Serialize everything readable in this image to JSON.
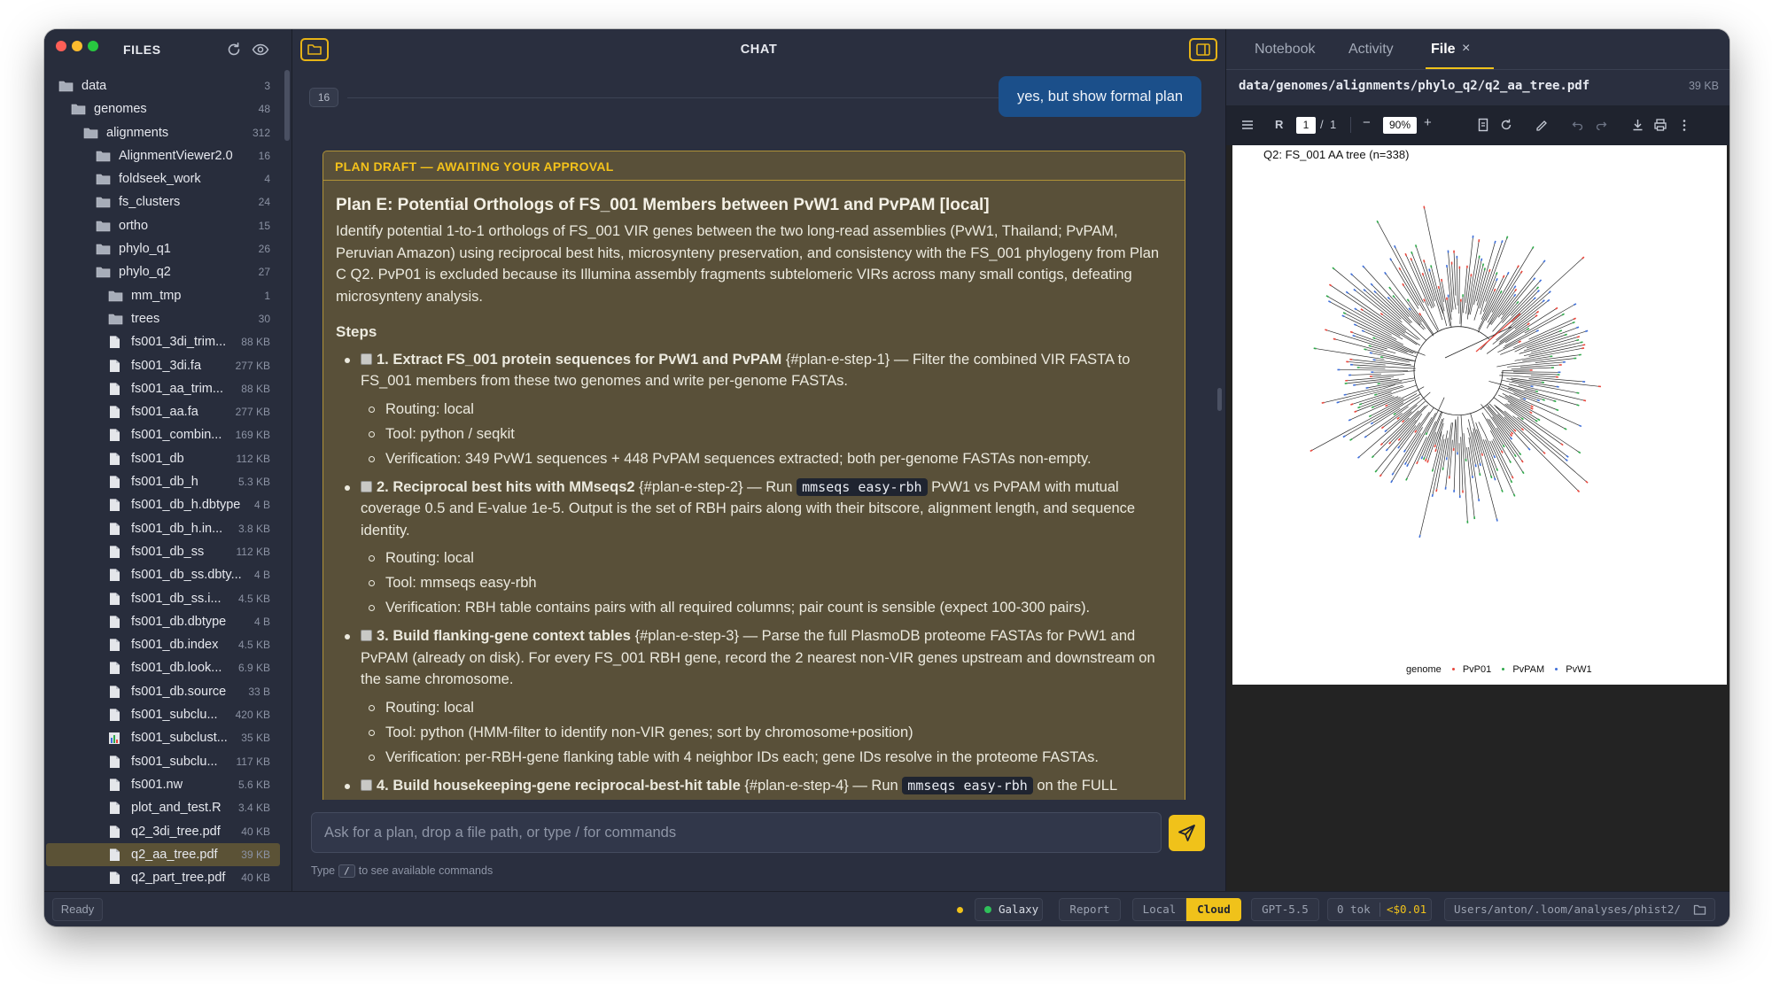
{
  "sidebar": {
    "title": "FILES",
    "tree": [
      {
        "name": "data",
        "count": "3",
        "type": "folder",
        "depth": 0
      },
      {
        "name": "genomes",
        "count": "48",
        "type": "folder",
        "depth": 1
      },
      {
        "name": "alignments",
        "count": "312",
        "type": "folder",
        "depth": 2
      },
      {
        "name": "AlignmentViewer2.0",
        "count": "16",
        "type": "folder",
        "depth": 3
      },
      {
        "name": "foldseek_work",
        "count": "4",
        "type": "folder",
        "depth": 3
      },
      {
        "name": "fs_clusters",
        "count": "24",
        "type": "folder",
        "depth": 3
      },
      {
        "name": "ortho",
        "count": "15",
        "type": "folder",
        "depth": 3
      },
      {
        "name": "phylo_q1",
        "count": "26",
        "type": "folder",
        "depth": 3
      },
      {
        "name": "phylo_q2",
        "count": "27",
        "type": "folder",
        "depth": 3
      },
      {
        "name": "mm_tmp",
        "count": "1",
        "type": "folder",
        "depth": 4
      },
      {
        "name": "trees",
        "count": "30",
        "type": "folder",
        "depth": 4
      },
      {
        "name": "fs001_3di_trim...",
        "count": "88 KB",
        "type": "file",
        "depth": 4
      },
      {
        "name": "fs001_3di.fa",
        "count": "277 KB",
        "type": "file",
        "depth": 4
      },
      {
        "name": "fs001_aa_trim...",
        "count": "88 KB",
        "type": "file",
        "depth": 4
      },
      {
        "name": "fs001_aa.fa",
        "count": "277 KB",
        "type": "file",
        "depth": 4
      },
      {
        "name": "fs001_combin...",
        "count": "169 KB",
        "type": "file",
        "depth": 4
      },
      {
        "name": "fs001_db",
        "count": "112 KB",
        "type": "file",
        "depth": 4
      },
      {
        "name": "fs001_db_h",
        "count": "5.3 KB",
        "type": "file",
        "depth": 4
      },
      {
        "name": "fs001_db_h.dbtype",
        "count": "4 B",
        "type": "file",
        "depth": 4
      },
      {
        "name": "fs001_db_h.in...",
        "count": "3.8 KB",
        "type": "file",
        "depth": 4
      },
      {
        "name": "fs001_db_ss",
        "count": "112 KB",
        "type": "file",
        "depth": 4
      },
      {
        "name": "fs001_db_ss.dbty...",
        "count": "4 B",
        "type": "file",
        "depth": 4
      },
      {
        "name": "fs001_db_ss.i...",
        "count": "4.5 KB",
        "type": "file",
        "depth": 4
      },
      {
        "name": "fs001_db.dbtype",
        "count": "4 B",
        "type": "file",
        "depth": 4
      },
      {
        "name": "fs001_db.index",
        "count": "4.5 KB",
        "type": "file",
        "depth": 4
      },
      {
        "name": "fs001_db.look...",
        "count": "6.9 KB",
        "type": "file",
        "depth": 4
      },
      {
        "name": "fs001_db.source",
        "count": "33 B",
        "type": "file",
        "depth": 4
      },
      {
        "name": "fs001_subclu...",
        "count": "420 KB",
        "type": "file",
        "depth": 4
      },
      {
        "name": "fs001_subclust...",
        "count": "35 KB",
        "type": "chart",
        "depth": 4
      },
      {
        "name": "fs001_subclu...",
        "count": "117 KB",
        "type": "file",
        "depth": 4
      },
      {
        "name": "fs001.nw",
        "count": "5.6 KB",
        "type": "file",
        "depth": 4
      },
      {
        "name": "plot_and_test.R",
        "count": "3.4 KB",
        "type": "file",
        "depth": 4
      },
      {
        "name": "q2_3di_tree.pdf",
        "count": "40 KB",
        "type": "file",
        "depth": 4
      },
      {
        "name": "q2_aa_tree.pdf",
        "count": "39 KB",
        "type": "file",
        "depth": 4,
        "selected": true
      },
      {
        "name": "q2_part_tree.pdf",
        "count": "40 KB",
        "type": "file",
        "depth": 4
      }
    ]
  },
  "chat": {
    "title": "CHAT",
    "turn_number": "16",
    "user_message": "yes, but show formal plan",
    "plan": {
      "banner": "PLAN DRAFT — AWAITING YOUR APPROVAL",
      "title": "Plan E: Potential Orthologs of FS_001 Members between PvW1 and PvPAM [local]",
      "description": "Identify potential 1-to-1 orthologs of FS_001 VIR genes between the two long-read assemblies (PvW1, Thailand; PvPAM, Peruvian Amazon) using reciprocal best hits, microsynteny preservation, and consistency with the FS_001 phylogeny from Plan C Q2. PvP01 is excluded because its Illumina assembly fragments subtelomeric VIRs across many small contigs, defeating microsynteny analysis.",
      "steps_heading": "Steps",
      "steps": [
        {
          "title": "1. Extract FS_001 protein sequences for PvW1 and PvPAM",
          "anchor": "{#plan-e-step-1}",
          "pre": " — Filter the combined VIR FASTA to FS_001 members from these two genomes and write per-genome FASTAs.",
          "code": "",
          "post": "",
          "routing": "Routing: local",
          "tool": "Tool: python / seqkit",
          "verification": "Verification: 349 PvW1 sequences + 448 PvPAM sequences extracted; both per-genome FASTAs non-empty."
        },
        {
          "title": "2. Reciprocal best hits with MMseqs2",
          "anchor": "{#plan-e-step-2}",
          "pre": " — Run ",
          "code": "mmseqs easy-rbh",
          "post": " PvW1 vs PvPAM with mutual coverage 0.5 and E-value 1e-5. Output is the set of RBH pairs along with their bitscore, alignment length, and sequence identity.",
          "routing": "Routing: local",
          "tool": "Tool: mmseqs easy-rbh",
          "verification": "Verification: RBH table contains pairs with all required columns; pair count is sensible (expect 100-300 pairs)."
        },
        {
          "title": "3. Build flanking-gene context tables",
          "anchor": "{#plan-e-step-3}",
          "pre": " — Parse the full PlasmoDB proteome FASTAs for PvW1 and PvPAM (already on disk). For every FS_001 RBH gene, record the 2 nearest non-VIR genes upstream and downstream on the same chromosome.",
          "code": "",
          "post": "",
          "routing": "Routing: local",
          "tool": "Tool: python (HMM-filter to identify non-VIR genes; sort by chromosome+position)",
          "verification": "Verification: per-RBH-gene flanking table with 4 neighbor IDs each; gene IDs resolve in the proteome FASTAs."
        },
        {
          "title": "4. Build housekeeping-gene reciprocal-best-hit table",
          "anchor": "{#plan-e-step-4}",
          "pre": " — Run ",
          "code": "mmseqs easy-rbh",
          "post": " on the FULL",
          "routing": "",
          "tool": "",
          "verification": ""
        }
      ]
    },
    "composer_placeholder": "Ask for a plan, drop a file path, or type / for commands",
    "hint_prefix": "Type",
    "hint_key": "/",
    "hint_suffix": "to see available commands"
  },
  "right_panel": {
    "tabs": [
      "Notebook",
      "Activity",
      "File"
    ],
    "active_tab": "File",
    "file_path": "data/genomes/alignments/phylo_q2/q2_aa_tree.pdf",
    "file_size": "39 KB",
    "pdf_toolbar": {
      "rotate_label": "R",
      "page_current": "1",
      "page_sep": "/",
      "page_total": "1",
      "zoom_minus": "−",
      "zoom": "90%",
      "zoom_plus": "+"
    },
    "pdf_page": {
      "title": "Q2: FS_001 AA tree (n=338)",
      "legend_title": "genome",
      "legend": [
        {
          "name": "PvP01",
          "color": "#e8473d"
        },
        {
          "name": "PvPAM",
          "color": "#2fa84a"
        },
        {
          "name": "PvW1",
          "color": "#3f6fd8"
        }
      ]
    }
  },
  "status_bar": {
    "ready": "Ready",
    "galaxy": "Galaxy",
    "report": "Report",
    "local": "Local",
    "cloud": "Cloud",
    "model": "GPT-5.5",
    "tokens": "0 tok",
    "cost": "<$0.01",
    "cwd": "Users/anton/.loom/analyses/phist2/"
  },
  "colors": {
    "accent": "#f0c21a",
    "dot_yellow": "#f0c21a",
    "dot_green": "#2fc05a"
  }
}
